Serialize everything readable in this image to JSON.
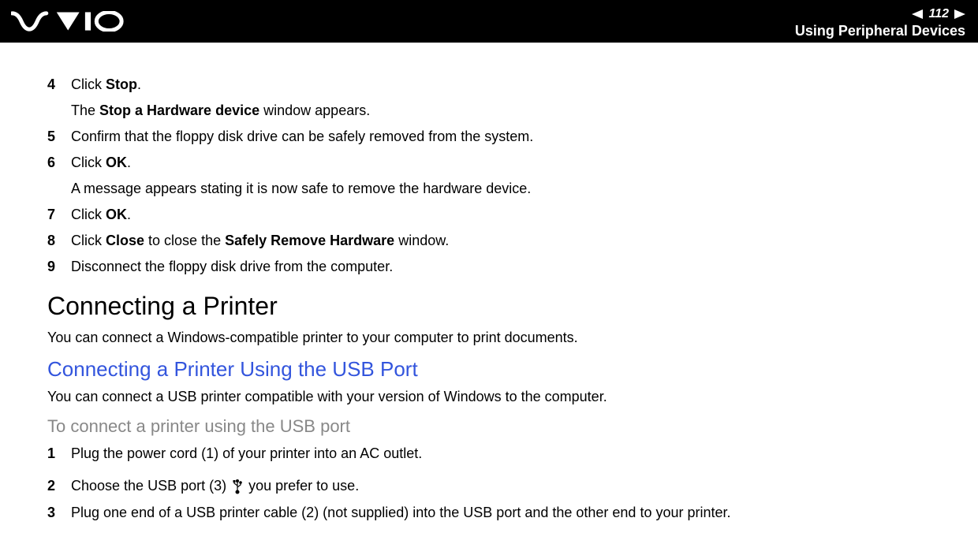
{
  "header": {
    "page_number": "112",
    "section_title": "Using Peripheral Devices"
  },
  "steps_a": [
    {
      "num": "4",
      "html": "Click <b>Stop</b>.",
      "sub": "The <b>Stop a Hardware device</b> window appears."
    },
    {
      "num": "5",
      "html": "Confirm that the floppy disk drive can be safely removed from the system."
    },
    {
      "num": "6",
      "html": "Click <b>OK</b>.",
      "sub": "A message appears stating it is now safe to remove the hardware device."
    },
    {
      "num": "7",
      "html": "Click <b>OK</b>."
    },
    {
      "num": "8",
      "html": "Click <b>Close</b> to close the <b>Safely Remove Hardware</b> window."
    },
    {
      "num": "9",
      "html": "Disconnect the floppy disk drive from the computer."
    }
  ],
  "section1": {
    "heading": "Connecting a Printer",
    "body": "You can connect a Windows-compatible printer to your computer to print documents."
  },
  "section2": {
    "heading": "Connecting a Printer Using the USB Port",
    "body": "You can connect a USB printer compatible with your version of Windows to the computer."
  },
  "section3": {
    "heading": "To connect a printer using the USB port"
  },
  "steps_b": [
    {
      "num": "1",
      "html": "Plug the power cord (1) of your printer into an AC outlet."
    },
    {
      "num": "2",
      "html": "Choose the USB port (3) {{USB}} you prefer to use."
    },
    {
      "num": "3",
      "html": "Plug one end of a USB printer cable (2) (not supplied) into the USB port and the other end to your printer."
    }
  ]
}
